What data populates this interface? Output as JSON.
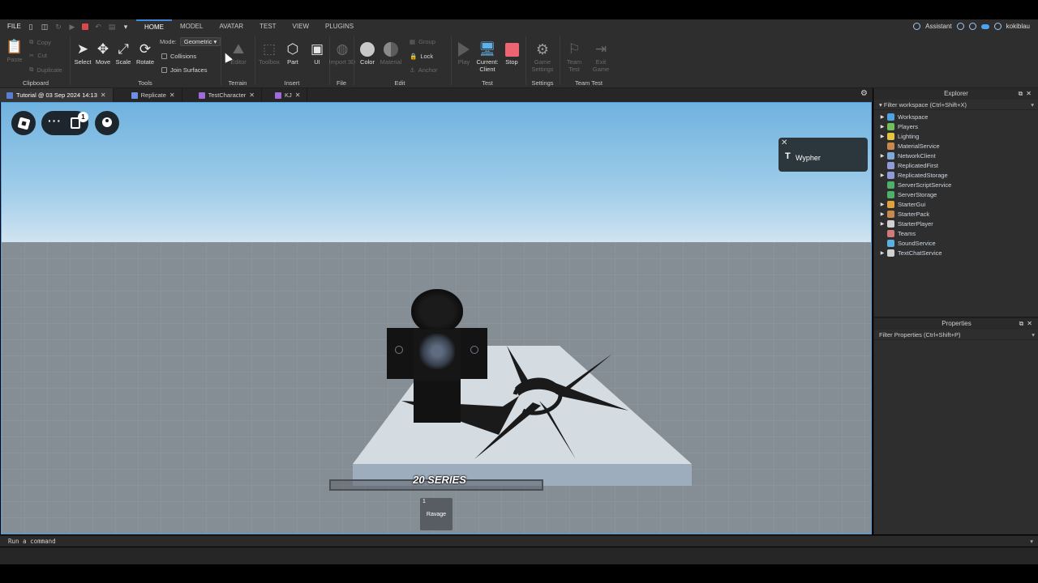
{
  "menubar": {
    "file_label": "FILE",
    "tabs": [
      {
        "label": "HOME",
        "active": true
      },
      {
        "label": "MODEL",
        "active": false
      },
      {
        "label": "AVATAR",
        "active": false
      },
      {
        "label": "TEST",
        "active": false
      },
      {
        "label": "VIEW",
        "active": false
      },
      {
        "label": "PLUGINS",
        "active": false
      }
    ],
    "assistant_label": "Assistant",
    "username": "kokiblau"
  },
  "ribbon": {
    "clipboard": {
      "paste": "Paste",
      "copy": "Copy",
      "cut": "Cut",
      "duplicate": "Duplicate",
      "group_label": "Clipboard"
    },
    "tools": {
      "select": "Select",
      "move": "Move",
      "scale": "Scale",
      "rotate": "Rotate",
      "mode_label": "Mode:",
      "mode_value": "Geometric",
      "collisions": "Collisions",
      "join_surfaces": "Join Surfaces",
      "group_label": "Tools"
    },
    "terrain": {
      "editor": "Editor",
      "group_label": "Terrain"
    },
    "insert": {
      "toolbox": "Toolbox",
      "part": "Part",
      "ui": "UI",
      "group_label": "Insert"
    },
    "file": {
      "import_3d": "Import 3D",
      "group_label": "File"
    },
    "edit": {
      "color": "Color",
      "material": "Material",
      "group": "Group",
      "lock": "Lock",
      "anchor": "Anchor",
      "group_label": "Edit"
    },
    "test": {
      "play": "Play",
      "current_client": "Current: Client",
      "stop": "Stop",
      "group_label": "Test"
    },
    "settings": {
      "game_settings": "Game Settings",
      "group_label": "Settings"
    },
    "team_test": {
      "team_test": "Team Test",
      "exit_game": "Exit Game",
      "group_label": "Team Test"
    }
  },
  "doc_tabs": [
    {
      "label": "Tutorial @ 03 Sep 2024 14:13",
      "active": true
    },
    {
      "label": "Replicate",
      "active": false
    },
    {
      "label": "TestCharacter",
      "active": false
    },
    {
      "label": "KJ",
      "active": false
    }
  ],
  "viewport": {
    "chat_badge_count": "1",
    "tool_popup_name": "Wypher",
    "series_label": "20 SERIES",
    "hotbar": {
      "slot_number": "1",
      "slot_name": "Ravage"
    }
  },
  "explorer": {
    "title": "Explorer",
    "filter_placeholder": "Filter workspace (Ctrl+Shift+X)",
    "items": [
      {
        "label": "Workspace",
        "expandable": true,
        "icon_color": "#4fa3e0"
      },
      {
        "label": "Players",
        "expandable": true,
        "icon_color": "#6fbf5a"
      },
      {
        "label": "Lighting",
        "expandable": true,
        "icon_color": "#e6c340"
      },
      {
        "label": "MaterialService",
        "expandable": false,
        "icon_color": "#c9884e"
      },
      {
        "label": "NetworkClient",
        "expandable": true,
        "icon_color": "#7fa9d9"
      },
      {
        "label": "ReplicatedFirst",
        "expandable": false,
        "icon_color": "#8f9bd6"
      },
      {
        "label": "ReplicatedStorage",
        "expandable": true,
        "icon_color": "#8f9bd6"
      },
      {
        "label": "ServerScriptService",
        "expandable": false,
        "icon_color": "#4fb06a"
      },
      {
        "label": "ServerStorage",
        "expandable": false,
        "icon_color": "#4fb06a"
      },
      {
        "label": "StarterGui",
        "expandable": true,
        "icon_color": "#e0a23e"
      },
      {
        "label": "StarterPack",
        "expandable": true,
        "icon_color": "#c9884e"
      },
      {
        "label": "StarterPlayer",
        "expandable": true,
        "icon_color": "#d0d0d0"
      },
      {
        "label": "Teams",
        "expandable": false,
        "icon_color": "#d07a7a"
      },
      {
        "label": "SoundService",
        "expandable": false,
        "icon_color": "#5ab0e0"
      },
      {
        "label": "TextChatService",
        "expandable": true,
        "icon_color": "#d0d0d0"
      }
    ]
  },
  "properties": {
    "title": "Properties",
    "filter_placeholder": "Filter Properties (Ctrl+Shift+P)"
  },
  "command_bar": {
    "placeholder": "Run a command"
  },
  "colors": {
    "accent": "#3f8ae0",
    "stop": "#ef6471",
    "viewport_border": "#4d9de0"
  }
}
